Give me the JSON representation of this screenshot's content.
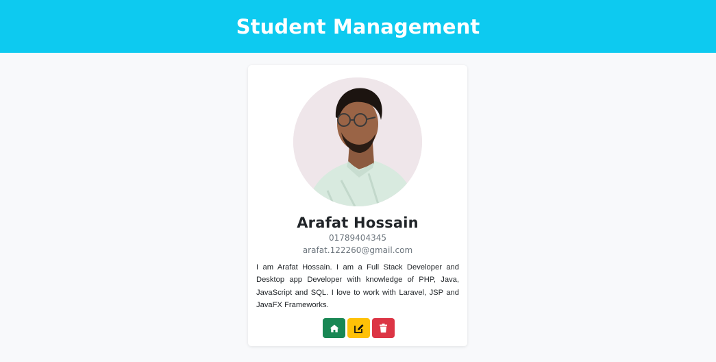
{
  "header": {
    "title": "Student Management"
  },
  "colors": {
    "header_bg": "#0dcaf0",
    "home_button": "#198754",
    "edit_button": "#ffc107",
    "delete_button": "#dc3545"
  },
  "profile": {
    "name": "Arafat Hossain",
    "phone": "01789404345",
    "email": "arafat.122260@gmail.com",
    "bio": "I am Arafat Hossain. I am a Full Stack Developer and Desktop app Developer with knowledge of PHP, Java, JavaScript and SQL. I love to work with Laravel, JSP and JavaFX Frameworks.",
    "photo": "profile-photo"
  },
  "actions": [
    {
      "name": "home",
      "icon": "home-icon"
    },
    {
      "name": "edit",
      "icon": "edit-icon"
    },
    {
      "name": "delete",
      "icon": "trash-icon"
    }
  ]
}
